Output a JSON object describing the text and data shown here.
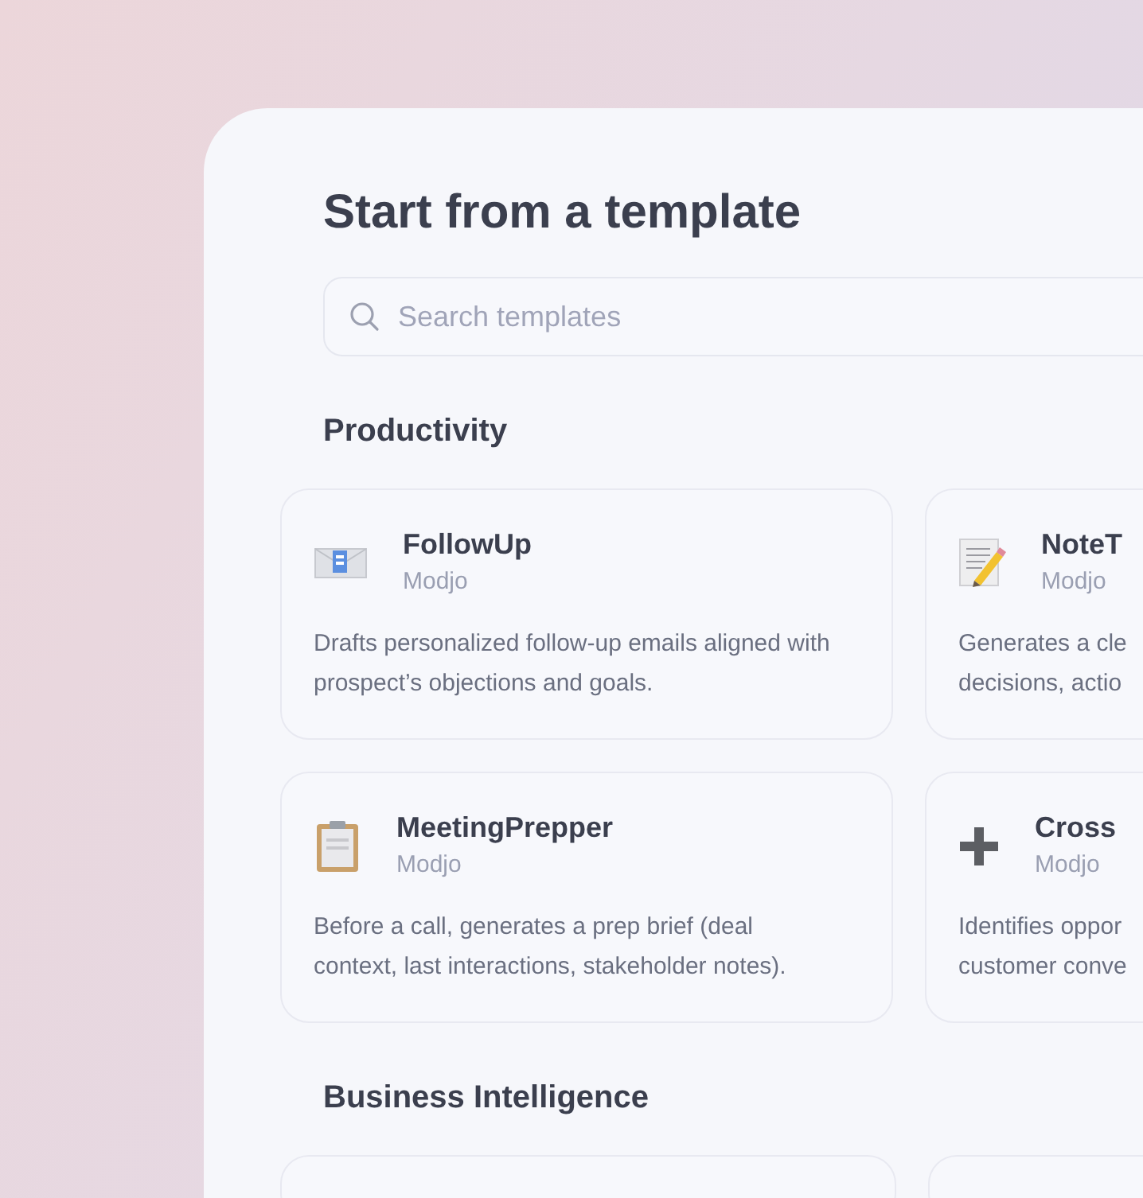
{
  "title": "Start from a template",
  "search": {
    "placeholder": "Search templates"
  },
  "sections": [
    {
      "heading": "Productivity",
      "templates": [
        {
          "name": "FollowUp",
          "author": "Modjo",
          "description": "Drafts personalized follow-up emails aligned with prospect’s objections and goals."
        },
        {
          "name": "NoteT",
          "author": "Modjo",
          "description_lines": [
            "Generates a cle",
            "decisions, actio"
          ]
        },
        {
          "name": "MeetingPrepper",
          "author": "Modjo",
          "description": "Before a call, generates a prep brief (deal context, last interactions, stakeholder notes)."
        },
        {
          "name": "Cross",
          "author": "Modjo",
          "description_lines": [
            "Identifies oppor",
            "customer conve"
          ]
        }
      ]
    },
    {
      "heading": "Business Intelligence"
    }
  ]
}
